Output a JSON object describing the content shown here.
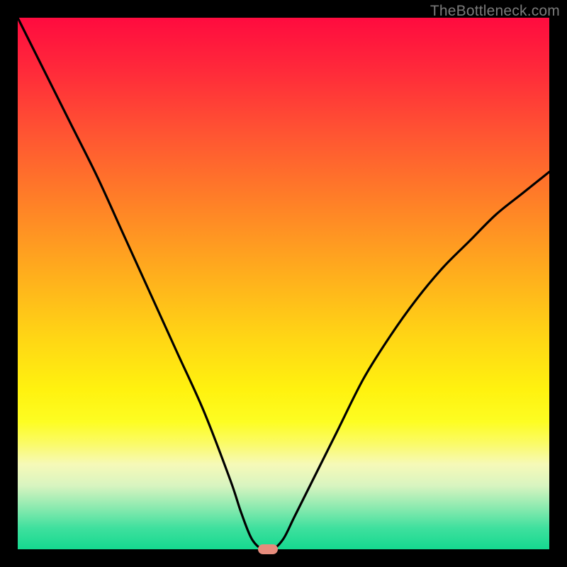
{
  "watermark": "TheBottleneck.com",
  "chart_data": {
    "type": "line",
    "title": "",
    "xlabel": "",
    "ylabel": "",
    "xlim": [
      0,
      100
    ],
    "ylim": [
      0,
      100
    ],
    "x": [
      0,
      5,
      10,
      15,
      20,
      25,
      30,
      35,
      40,
      42,
      44,
      46,
      48,
      50,
      52,
      55,
      60,
      65,
      70,
      75,
      80,
      85,
      90,
      95,
      100
    ],
    "values": [
      100,
      90,
      80,
      70,
      59,
      48,
      37,
      26,
      13,
      7,
      2,
      0,
      0,
      2,
      6,
      12,
      22,
      32,
      40,
      47,
      53,
      58,
      63,
      67,
      71
    ],
    "marker": {
      "x": 47,
      "y": 0,
      "color": "#e68c7c"
    },
    "gradient_stops": [
      {
        "pos": 0,
        "color": "#ff0b3f"
      },
      {
        "pos": 50,
        "color": "#ffad1d"
      },
      {
        "pos": 75,
        "color": "#fdfd22"
      },
      {
        "pos": 100,
        "color": "#15d98f"
      }
    ]
  },
  "colors": {
    "background": "#000000",
    "curve": "#000000",
    "marker": "#e68c7c",
    "watermark": "#7a7a7a"
  }
}
